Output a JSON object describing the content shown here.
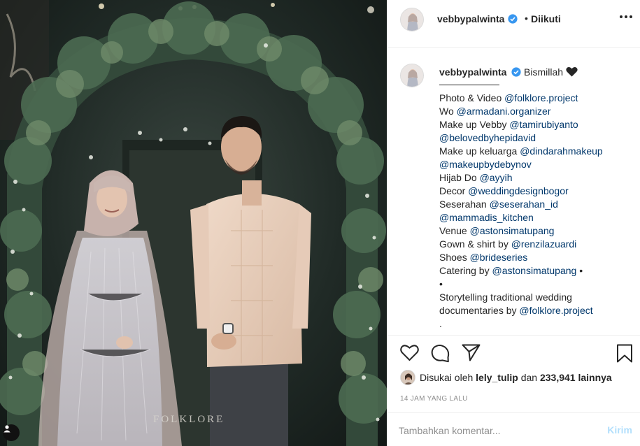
{
  "photo": {
    "watermark": "FOLKLORE"
  },
  "header": {
    "username": "vebbypalwinta",
    "separator": "•",
    "follow_status": "Diikuti",
    "more_icon": "more-horizontal-icon"
  },
  "caption": {
    "username": "vebbypalwinta",
    "first_line": "Bismillah",
    "lines": [
      {
        "text": "Photo & Video ",
        "mention": "@folklore.project"
      },
      {
        "text": "Wo ",
        "mention": "@armadani.organizer"
      },
      {
        "text": "Make up Vebby ",
        "mention": "@tamirubiyanto"
      },
      {
        "text": "",
        "mention": "@belovedbyhepidavid"
      },
      {
        "text": "Make up keluarga ",
        "mention": "@dindarahmakeup"
      },
      {
        "text": "",
        "mention": "@makeupbydebynov"
      },
      {
        "text": "Hijab Do ",
        "mention": "@ayyih"
      },
      {
        "text": "Decor ",
        "mention": "@weddingdesignbogor"
      },
      {
        "text": "Seserahan ",
        "mention": "@seserahan_id"
      },
      {
        "text": "",
        "mention": "@mammadis_kitchen"
      },
      {
        "text": "Venue ",
        "mention": "@astonsimatupang"
      },
      {
        "text": "Gown & shirt by ",
        "mention": "@renzilazuardi"
      },
      {
        "text": "Shoes ",
        "mention": "@brideseries"
      },
      {
        "text": "Catering by ",
        "mention": "@astonsimatupang",
        "suffix": " •"
      },
      {
        "text": "•",
        "mention": ""
      },
      {
        "text": "Storytelling traditional wedding",
        "mention": ""
      },
      {
        "text": "documentaries by ",
        "mention": "@folklore.project"
      },
      {
        "text": ".",
        "mention": ""
      }
    ]
  },
  "actions": {
    "like_icon": "heart-outline-icon",
    "comment_icon": "comment-bubble-icon",
    "share_icon": "paper-plane-icon",
    "save_icon": "bookmark-icon"
  },
  "likes": {
    "prefix": "Disukai oleh",
    "user": "lely_tulip",
    "joiner": "dan",
    "count": "233,941 lainnya"
  },
  "timestamp": "14 JAM YANG LALU",
  "comment": {
    "placeholder": "Tambahkan komentar...",
    "post_label": "Kirim"
  },
  "colors": {
    "verified": "#3897f0",
    "mention": "#00376b",
    "post_disabled": "#b2dffc",
    "muted": "#8e8e8e"
  }
}
